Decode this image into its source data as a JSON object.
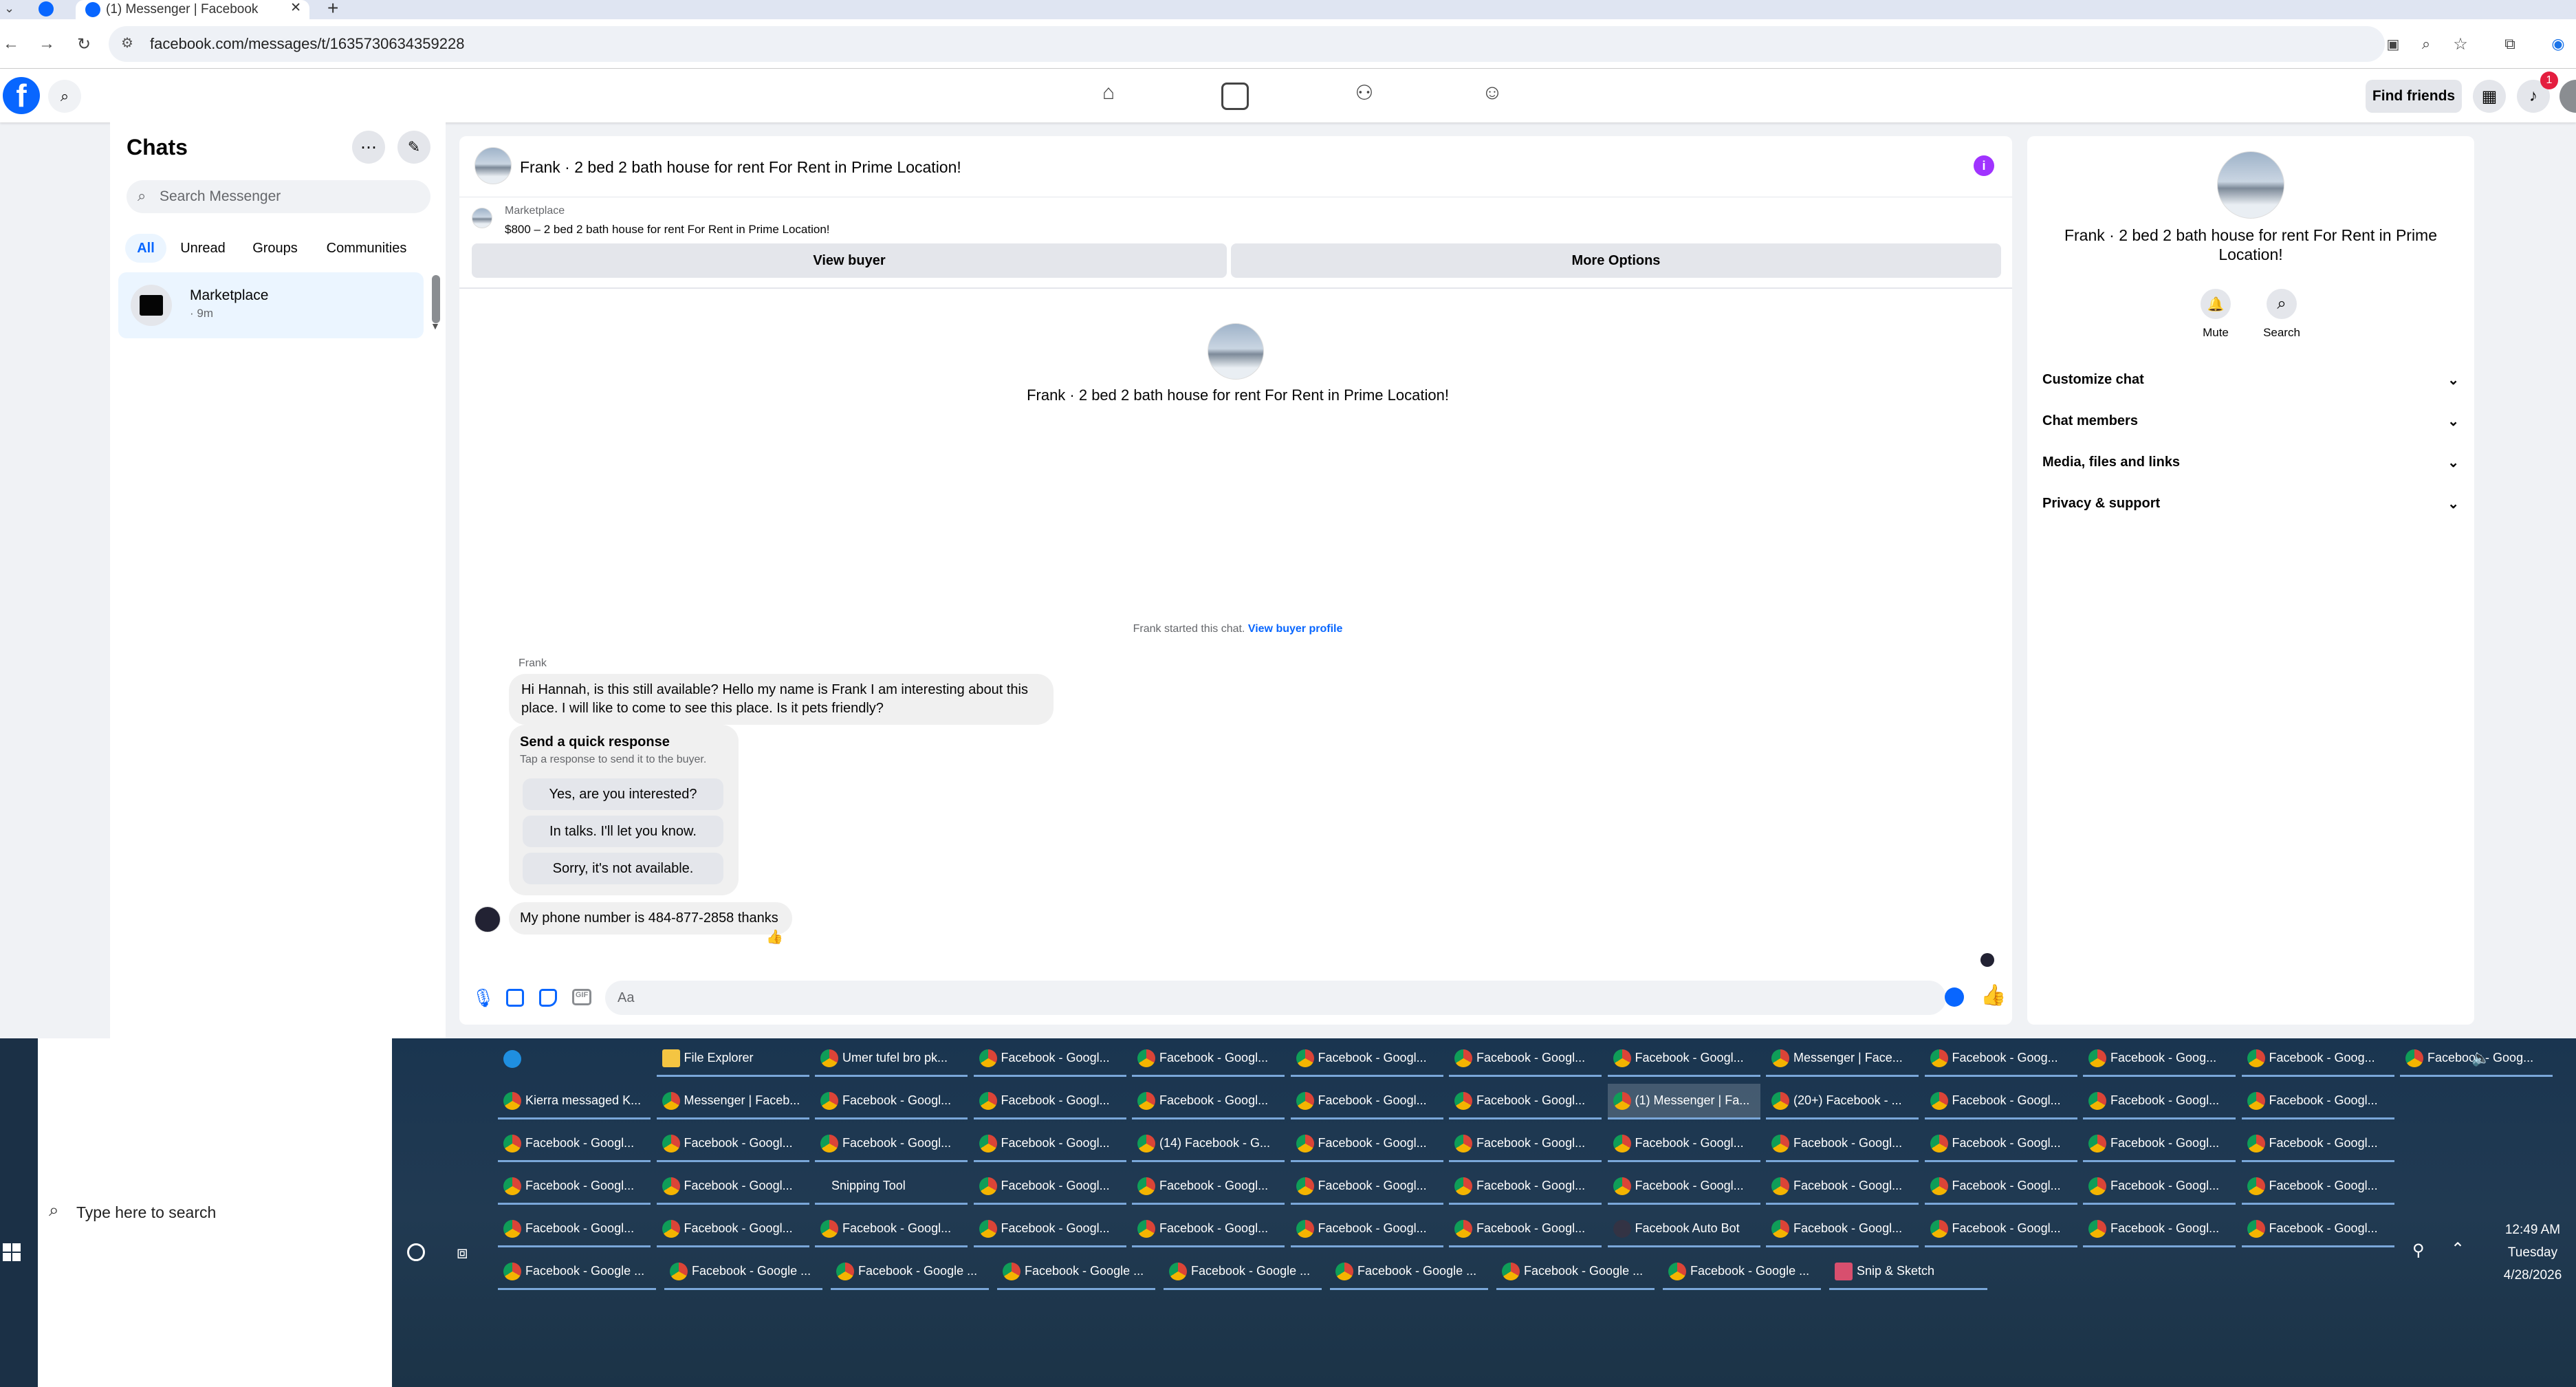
{
  "browser": {
    "tab_title": "(1) Messenger | Facebook",
    "url": "facebook.com/messages/t/1635730634359228"
  },
  "fb": {
    "logo": "f",
    "find_friends": "Find friends",
    "notif_count": "1"
  },
  "chats": {
    "title": "Chats",
    "search_placeholder": "Search Messenger",
    "filters": [
      "All",
      "Unread",
      "Groups",
      "Communities"
    ],
    "items": [
      {
        "name": "Marketplace",
        "time": "· 9m"
      }
    ]
  },
  "conversation": {
    "title": "Frank · 2 bed 2 bath house for rent For Rent in Prime Location!",
    "marketplace_label": "Marketplace",
    "listing": "$800 – 2 bed 2 bath house for rent For Rent in Prime Location!",
    "view_buyer": "View buyer",
    "more_options": "More Options",
    "center_title": "Frank · 2 bed 2 bath house for rent For Rent in Prime Location!",
    "started_text": "Frank started this chat.",
    "view_buyer_profile": "View buyer profile",
    "sender": "Frank",
    "message1": "Hi Hannah, is this still available? Hello my name is Frank I am interesting about this place. I will like to come to see this place. Is it pets friendly?",
    "quick_title": "Send a quick response",
    "quick_sub": "Tap a response to send it to the buyer.",
    "quick_replies": [
      "Yes, are you interested?",
      "In talks. I'll let you know.",
      "Sorry, it's not available."
    ],
    "message2": "My phone number is 484-877-2858 thanks",
    "input_placeholder": "Aa"
  },
  "details": {
    "title": "Frank · 2 bed 2 bath house for rent For Rent in Prime Location!",
    "mute": "Mute",
    "search": "Search",
    "sections": [
      "Customize chat",
      "Chat members",
      "Media, files and links",
      "Privacy & support"
    ]
  },
  "taskbar": {
    "search_placeholder": "Type here to search",
    "time": "12:49 AM",
    "day": "Tuesday",
    "date": "4/28/2026",
    "rows": [
      [
        "",
        "File Explorer",
        "Umer tufel bro pk...",
        "Facebook - Googl...",
        "Facebook - Googl...",
        "Facebook - Googl...",
        "Facebook - Googl...",
        "Facebook - Googl...",
        "Messenger | Face...",
        "Facebook - Goog...",
        "Facebook - Goog...",
        "Facebook - Goog...",
        "Facebook - Goog..."
      ],
      [
        "Kierra messaged K...",
        "Messenger | Faceb...",
        "Facebook - Googl...",
        "Facebook - Googl...",
        "Facebook - Googl...",
        "Facebook - Googl...",
        "Facebook - Googl...",
        "(1) Messenger | Fa...",
        "(20+) Facebook - ...",
        "Facebook - Googl...",
        "Facebook - Googl...",
        "Facebook - Googl..."
      ],
      [
        "Facebook - Googl...",
        "Facebook - Googl...",
        "Facebook - Googl...",
        "Facebook - Googl...",
        "(14) Facebook - G...",
        "Facebook - Googl...",
        "Facebook - Googl...",
        "Facebook - Googl...",
        "Facebook - Googl...",
        "Facebook - Googl...",
        "Facebook - Googl...",
        "Facebook - Googl..."
      ],
      [
        "Facebook - Googl...",
        "Facebook - Googl...",
        "Snipping Tool",
        "Facebook - Googl...",
        "Facebook - Googl...",
        "Facebook - Googl...",
        "Facebook - Googl...",
        "Facebook - Googl...",
        "Facebook - Googl...",
        "Facebook - Googl...",
        "Facebook - Googl...",
        "Facebook - Googl..."
      ],
      [
        "Facebook - Googl...",
        "Facebook - Googl...",
        "Facebook - Googl...",
        "Facebook - Googl...",
        "Facebook - Googl...",
        "Facebook - Googl...",
        "Facebook - Googl...",
        "Facebook Auto Bot",
        "Facebook - Googl...",
        "Facebook - Googl...",
        "Facebook - Googl...",
        "Facebook - Googl..."
      ],
      [
        "Facebook - Google ...",
        "Facebook - Google ...",
        "Facebook - Google ...",
        "Facebook - Google ...",
        "Facebook - Google ...",
        "Facebook - Google ...",
        "Facebook - Google ...",
        "Facebook - Google ...",
        "Snip & Sketch"
      ]
    ]
  },
  "colors": {
    "fb_blue": "#0866ff",
    "messenger_purple": "#a033ff",
    "taskbar": "#1f3850"
  }
}
